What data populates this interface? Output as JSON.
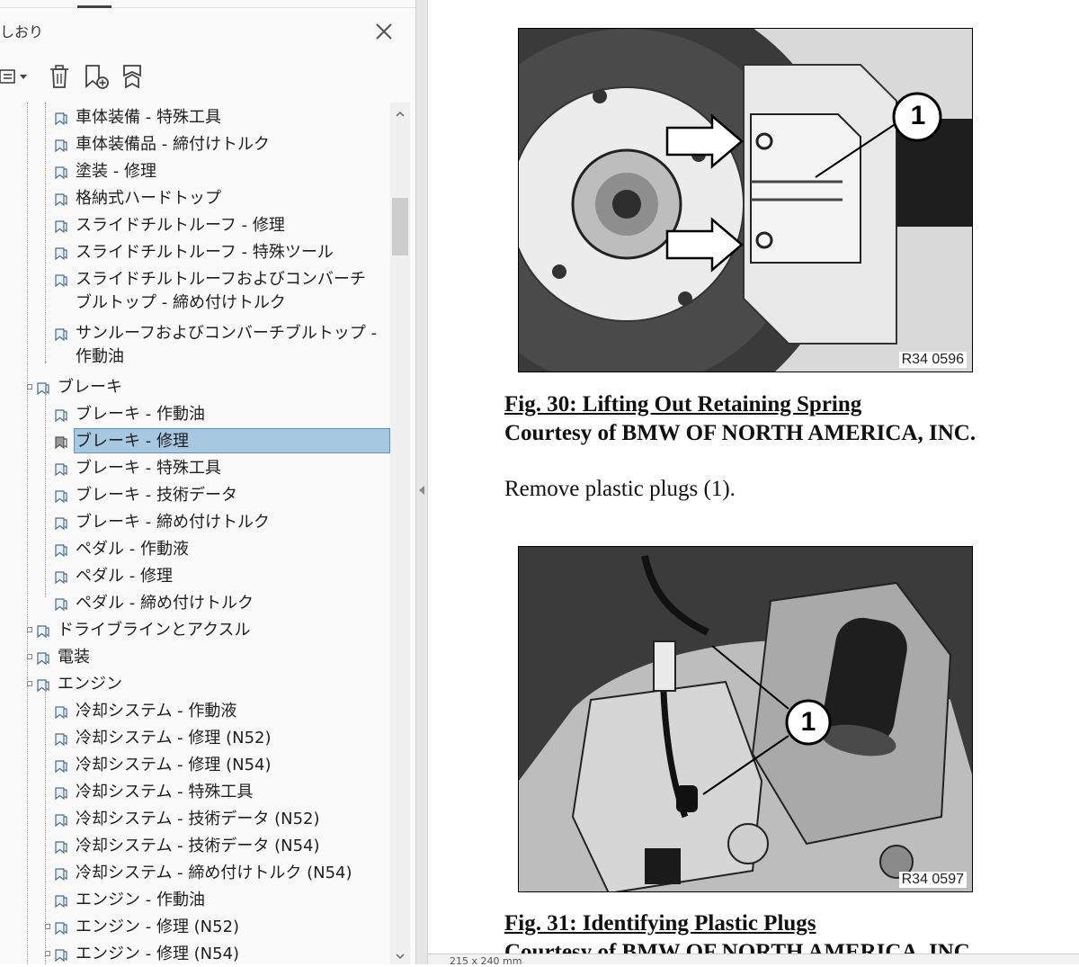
{
  "panel": {
    "title": "しおり",
    "toolbar": {
      "options_icon": "list-options-icon",
      "delete_icon": "trash-icon",
      "new_bookmark_icon": "bookmark-add-icon",
      "tag_icon": "bookmark-tag-icon"
    },
    "bookmarks": [
      {
        "label": "車体装備 - 特殊工具",
        "level": 2
      },
      {
        "label": "車体装備品 - 締付けトルク",
        "level": 2
      },
      {
        "label": "塗装 - 修理",
        "level": 2
      },
      {
        "label": "格納式ハードトップ",
        "level": 2
      },
      {
        "label": "スライドチルトルーフ - 修理",
        "level": 2
      },
      {
        "label": "スライドチルトルーフ - 特殊ツール",
        "level": 2
      },
      {
        "label": "スライドチルトルーフおよびコンバーチブルトップ - 締め付けトルク",
        "level": 2,
        "lines": 2
      },
      {
        "label": "サンルーフおよびコンバーチブルトップ - 作動油",
        "level": 2,
        "lines": 2
      },
      {
        "label": "ブレーキ",
        "level": 1,
        "expandable": true
      },
      {
        "label": "ブレーキ - 作動油",
        "level": 2
      },
      {
        "label": "ブレーキ - 修理",
        "level": 2,
        "selected": true
      },
      {
        "label": "ブレーキ - 特殊工具",
        "level": 2
      },
      {
        "label": "ブレーキ - 技術データ",
        "level": 2
      },
      {
        "label": "ブレーキ - 締め付けトルク",
        "level": 2
      },
      {
        "label": "ペダル - 作動液",
        "level": 2
      },
      {
        "label": "ペダル - 修理",
        "level": 2
      },
      {
        "label": "ペダル - 締め付けトルク",
        "level": 2
      },
      {
        "label": "ドライブラインとアクスル",
        "level": 1,
        "expandable": true
      },
      {
        "label": "電装",
        "level": 1,
        "expandable": true
      },
      {
        "label": "エンジン",
        "level": 1,
        "expandable": true
      },
      {
        "label": "冷却システム - 作動液",
        "level": 2
      },
      {
        "label": "冷却システム - 修理 (N52)",
        "level": 2
      },
      {
        "label": "冷却システム - 修理 (N54)",
        "level": 2
      },
      {
        "label": "冷却システム - 特殊工具",
        "level": 2
      },
      {
        "label": "冷却システム - 技術データ (N52)",
        "level": 2
      },
      {
        "label": "冷却システム - 技術データ (N54)",
        "level": 2
      },
      {
        "label": "冷却システム - 締め付けトルク (N54)",
        "level": 2
      },
      {
        "label": "エンジン - 作動油",
        "level": 2
      },
      {
        "label": "エンジン - 修理 (N52)",
        "level": 2,
        "expandable": true
      },
      {
        "label": "エンジン - 修理 (N54)",
        "level": 2,
        "expandable": true
      }
    ]
  },
  "document": {
    "figure1": {
      "code": "R34 0596",
      "callout": "1",
      "caption": "Fig. 30: Lifting Out Retaining Spring",
      "courtesy": "Courtesy of BMW OF NORTH AMERICA, INC."
    },
    "instruction": "Remove plastic plugs (1).",
    "figure2": {
      "code": "R34 0597",
      "callout": "1",
      "caption": "Fig. 31: Identifying Plastic Plugs",
      "courtesy": "Courtesy of BMW OF NORTH AMERICA, INC."
    },
    "status": "215 x 240 mm"
  },
  "colors": {
    "selection": "#a6c8e0",
    "selection_border": "#5c93bd",
    "panel_bg": "#fafafa"
  }
}
